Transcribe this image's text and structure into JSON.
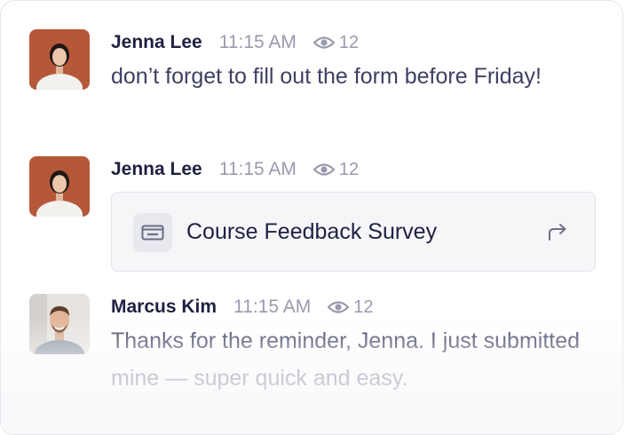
{
  "messages": [
    {
      "author": "Jenna Lee",
      "time": "11:15 AM",
      "views": "12",
      "text": "don’t forget to fill out the form before Friday!"
    },
    {
      "author": "Jenna Lee",
      "time": "11:15 AM",
      "views": "12",
      "attachment": {
        "title": "Course Feedback Survey",
        "icon": "form-icon",
        "action_icon": "share-icon"
      }
    },
    {
      "author": "Marcus Kim",
      "time": "11:15 AM",
      "views": "12",
      "text": "Thanks for the reminder, Jenna. I just submitted mine — super quick and easy."
    }
  ],
  "icons": {
    "views": "eye-icon"
  },
  "colors": {
    "name": "#1f2041",
    "muted": "#9a9aae",
    "body_text": "#3f4062",
    "card_bg": "#f6f6f9",
    "avatar_bg_jenna": "#b45a3a"
  }
}
